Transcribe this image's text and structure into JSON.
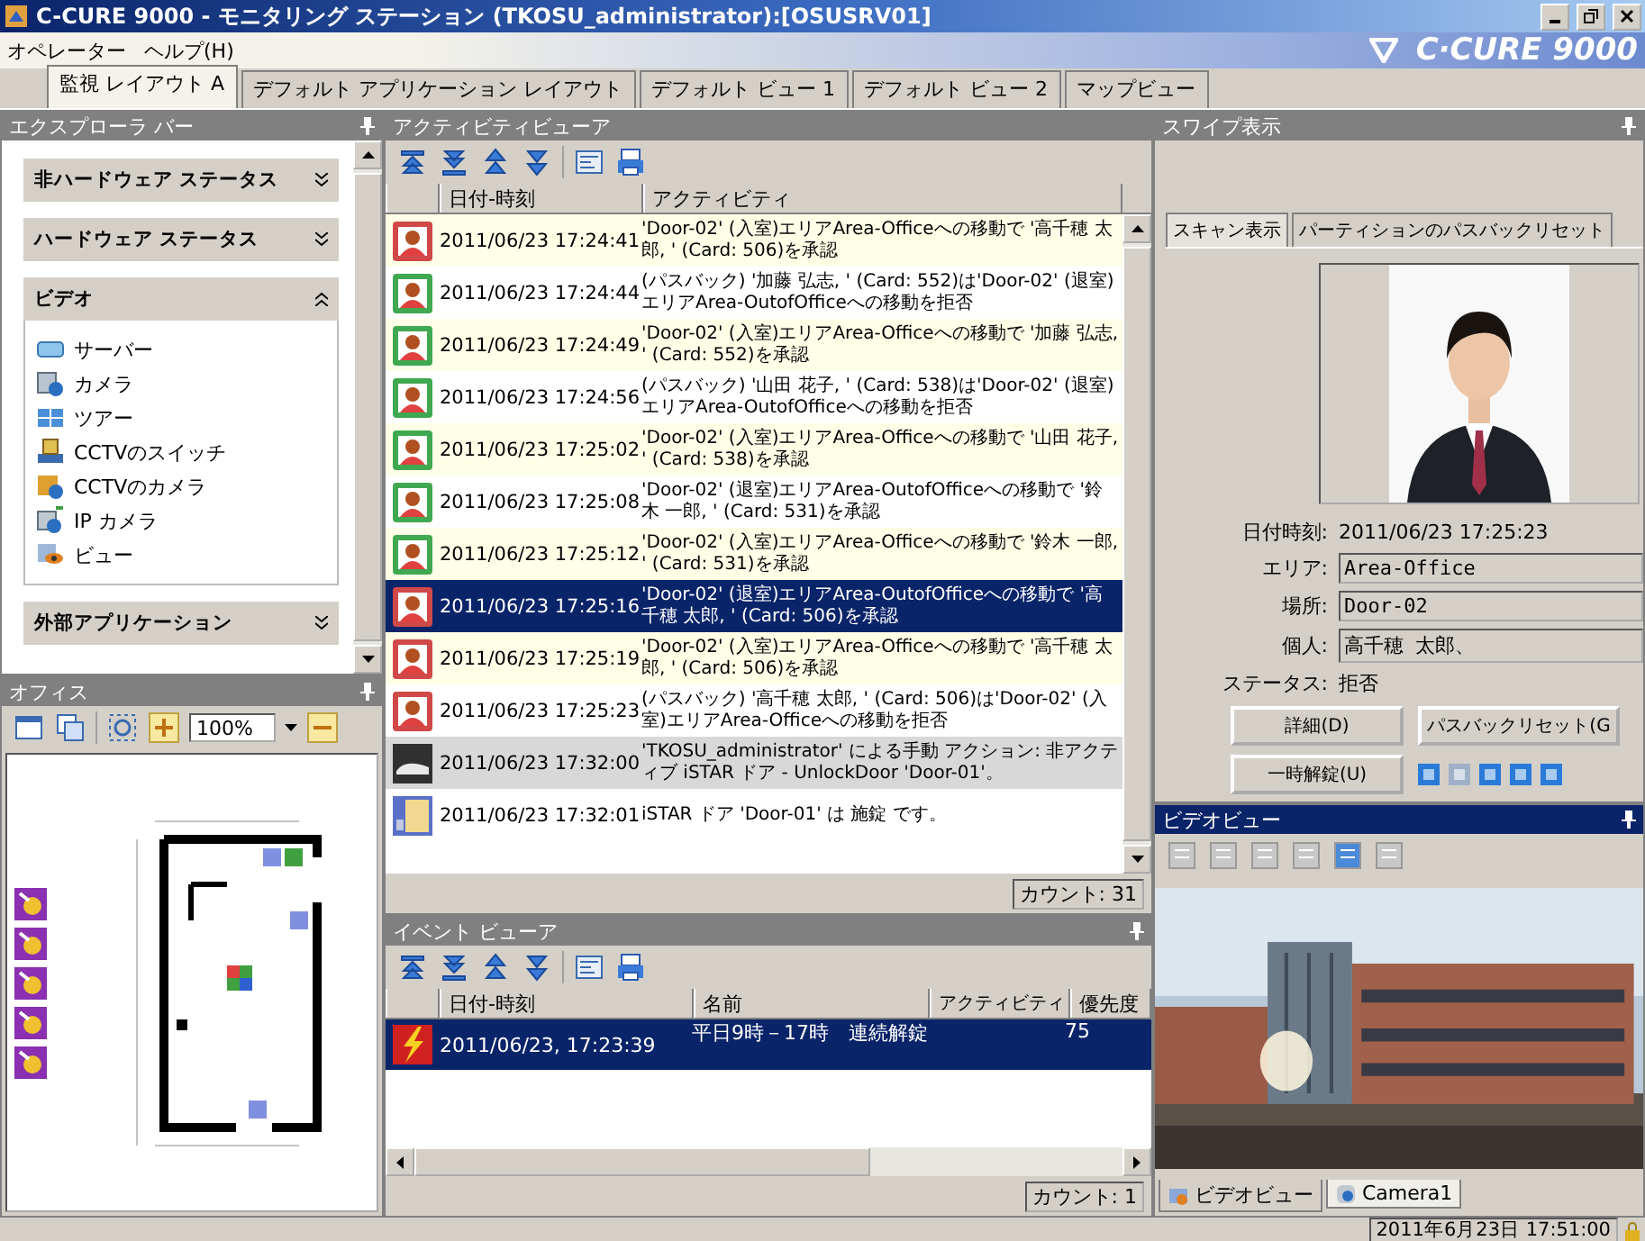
{
  "window": {
    "title": "C-CURE 9000 - モニタリング ステーション (TKOSU_administrator):[OSUSRV01]"
  },
  "menu": [
    "オペレーター",
    "ヘルプ(H)"
  ],
  "logo": "C·CURE 9000",
  "tabs": [
    {
      "label": "監視 レイアウト A",
      "selected": true
    },
    {
      "label": "デフォルト アプリケーション レイアウト",
      "selected": false
    },
    {
      "label": "デフォルト ビュー 1",
      "selected": false
    },
    {
      "label": "デフォルト ビュー 2",
      "selected": false
    },
    {
      "label": "マップビュー",
      "selected": false
    }
  ],
  "explorer": {
    "title": "エクスプローラ バー",
    "sections": [
      {
        "label": "非ハードウェア ステータス",
        "expanded": false
      },
      {
        "label": "ハードウェア ステータス",
        "expanded": false
      },
      {
        "label": "ビデオ",
        "expanded": true,
        "items": [
          {
            "label": "サーバー",
            "kind": "server"
          },
          {
            "label": "カメラ",
            "kind": "camera"
          },
          {
            "label": "ツアー",
            "kind": "tour"
          },
          {
            "label": "CCTVのスイッチ",
            "kind": "switch"
          },
          {
            "label": "CCTVのカメラ",
            "kind": "cctv"
          },
          {
            "label": "IP カメラ",
            "kind": "ip"
          },
          {
            "label": "ビュー",
            "kind": "view"
          }
        ]
      },
      {
        "label": "外部アプリケーション",
        "expanded": false
      }
    ]
  },
  "office": {
    "title": "オフィス",
    "zoom": "100%"
  },
  "activity": {
    "title": "アクティビティビューア",
    "columns": [
      "日付-時刻",
      "アクティビティ"
    ],
    "rows": [
      {
        "time": "2011/06/23 17:24:41",
        "text": "'Door-02' (入室)エリアArea-Officeへの移動で '高千穂 太郎, ' (Card: 506)を承認",
        "kind": "red",
        "color": "#ffffe8",
        "selected": false
      },
      {
        "time": "2011/06/23 17:24:44",
        "text": "(パスバック) '加藤 弘志, ' (Card: 552)は'Door-02' (退室)エリアArea-OutofOfficeへの移動を拒否",
        "kind": "green",
        "color": "#ffffff",
        "selected": false
      },
      {
        "time": "2011/06/23 17:24:49",
        "text": "'Door-02' (入室)エリアArea-Officeへの移動で '加藤 弘志, ' (Card: 552)を承認",
        "kind": "green",
        "color": "#ffffe8",
        "selected": false
      },
      {
        "time": "2011/06/23 17:24:56",
        "text": "(パスバック) '山田 花子, ' (Card: 538)は'Door-02' (退室)エリアArea-OutofOfficeへの移動を拒否",
        "kind": "green",
        "color": "#ffffff",
        "selected": false
      },
      {
        "time": "2011/06/23 17:25:02",
        "text": "'Door-02' (入室)エリアArea-Officeへの移動で '山田 花子, ' (Card: 538)を承認",
        "kind": "green",
        "color": "#ffffe8",
        "selected": false
      },
      {
        "time": "2011/06/23 17:25:08",
        "text": "'Door-02' (退室)エリアArea-OutofOfficeへの移動で '鈴木 一郎, ' (Card: 531)を承認",
        "kind": "green",
        "color": "#ffffff",
        "selected": false
      },
      {
        "time": "2011/06/23 17:25:12",
        "text": "'Door-02' (入室)エリアArea-Officeへの移動で '鈴木 一郎, ' (Card: 531)を承認",
        "kind": "green",
        "color": "#ffffe8",
        "selected": false
      },
      {
        "time": "2011/06/23 17:25:16",
        "text": "'Door-02' (退室)エリアArea-OutofOfficeへの移動で '高千穂 太郎, ' (Card: 506)を承認",
        "kind": "red",
        "selected": true
      },
      {
        "time": "2011/06/23 17:25:19",
        "text": "'Door-02' (入室)エリアArea-Officeへの移動で '高千穂 太郎, ' (Card: 506)を承認",
        "kind": "red",
        "color": "#ffffe8",
        "selected": false
      },
      {
        "time": "2011/06/23 17:25:23",
        "text": "(パスバック) '高千穂 太郎, ' (Card: 506)は'Door-02' (入室)エリアArea-Officeへの移動を拒否",
        "kind": "red",
        "color": "#ffffff",
        "selected": false
      },
      {
        "time": "2011/06/23 17:32:00",
        "text": "'TKOSU_administrator' による手動 アクション: 非アクティブ iSTAR ドア - UnlockDoor 'Door-01'。",
        "kind": "manual",
        "color": "#d8d8d8",
        "selected": false
      },
      {
        "time": "2011/06/23 17:32:01",
        "text": "iSTAR ドア 'Door-01' は 施錠 です。",
        "kind": "door",
        "color": "#ffffff",
        "selected": false
      }
    ],
    "count": "カウント: 31"
  },
  "events": {
    "title": "イベント ビューア",
    "columns": [
      "日付-時刻",
      "名前",
      "アクティビティ",
      "優先度"
    ],
    "rows": [
      {
        "time": "2011/06/23, 17:23:39",
        "name": "平日9時－17時　連続解錠",
        "priority": "75",
        "selected": true
      }
    ],
    "count": "カウント: 1"
  },
  "swipe": {
    "title": "スワイプ表示",
    "tabs": [
      {
        "label": "スキャン表示",
        "selected": true
      },
      {
        "label": "パーティションのパスバックリセット",
        "selected": false
      }
    ],
    "photo": {
      "kind": "picture"
    },
    "fields": [
      {
        "label": "日付時刻:",
        "value": "2011/06/23 17:25:23",
        "kind": "text"
      },
      {
        "label": "エリア:",
        "value": "Area-Office",
        "kind": "box"
      },
      {
        "label": "場所:",
        "value": "Door-02",
        "kind": "box"
      },
      {
        "label": "個人:",
        "value": "高千穂 太郎、",
        "kind": "box"
      },
      {
        "label": "ステータス:",
        "value": "拒否",
        "kind": "text"
      }
    ],
    "buttons": [
      "詳細(D)",
      "パスバックリセット(G",
      "一時解錠(U)"
    ]
  },
  "video": {
    "title": "ビデオビュー",
    "tabs": [
      {
        "label": "ビデオビュー",
        "selected": false
      },
      {
        "label": "Camera1",
        "selected": true
      }
    ]
  },
  "status": "2011年6月23日 17:51:00"
}
